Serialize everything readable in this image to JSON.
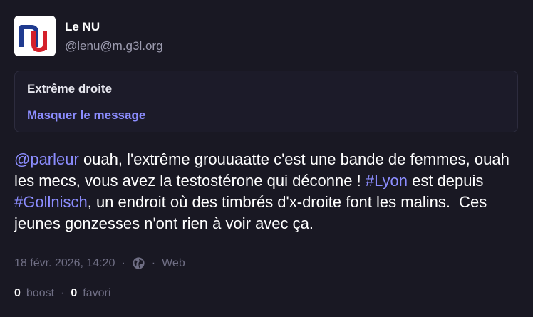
{
  "account": {
    "display_name": "Le NU",
    "handle": "@lenu@m.g3l.org",
    "avatar_icon": "le-nu-logo"
  },
  "content_warning": {
    "title": "Extrême droite",
    "toggle_label": "Masquer le message"
  },
  "post": {
    "mention": "@parleur",
    "text_1": " ouah, l'extrême grouuaatte c'est une bande de femmes, ouah les mecs, vous avez la testostérone qui déconne ! ",
    "hashtag_1": "#Lyon",
    "text_2": " est depuis ",
    "hashtag_2": "#Gollnisch",
    "text_3": ", un endroit où des timbrés d'x-droite font les malins.  Ces jeunes gonzesses n'ont rien à voir avec ça."
  },
  "meta": {
    "timestamp": "18 févr. 2026, 14:20",
    "separator": "·",
    "visibility_icon": "globe-icon",
    "application": "Web"
  },
  "stats": {
    "boost_count": "0",
    "boost_label": "boost",
    "separator": "·",
    "favourite_count": "0",
    "favourite_label": "favori"
  },
  "colors": {
    "background": "#191823",
    "accent": "#8c8dff",
    "muted": "#6f6e84",
    "logo_blue": "#1f3a8f",
    "logo_red": "#d4202a"
  }
}
